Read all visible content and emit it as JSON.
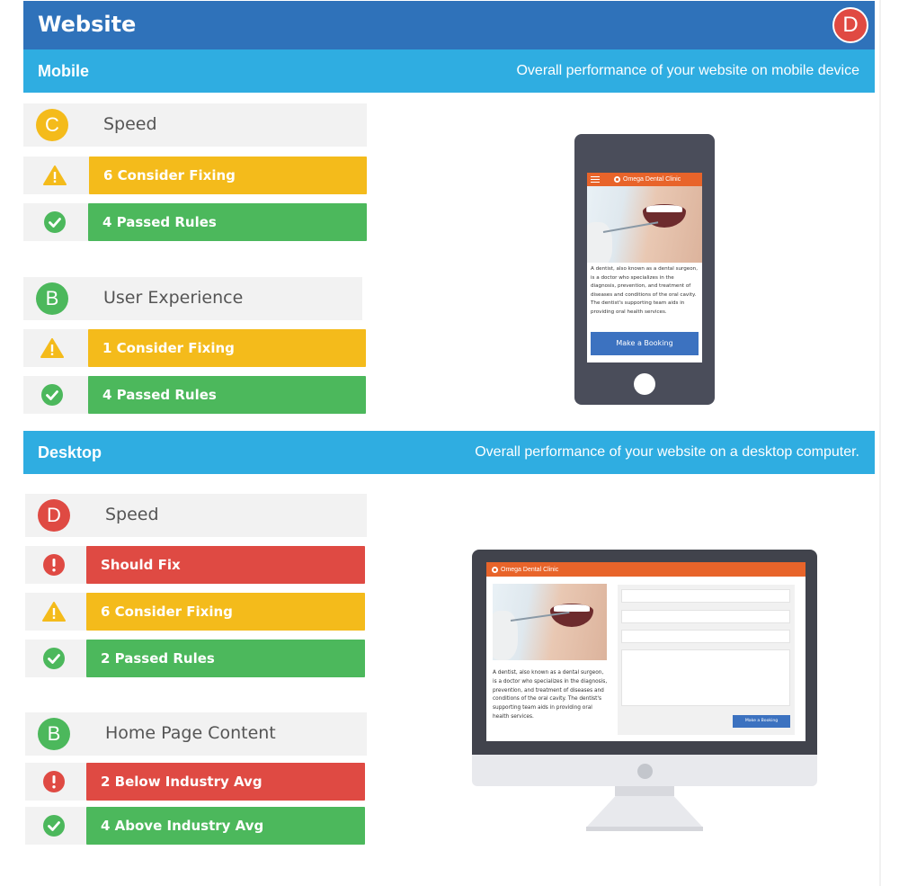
{
  "header": {
    "title": "Website",
    "overall_grade": "D",
    "overall_grade_color": "#e04a42"
  },
  "sections": {
    "mobile": {
      "name": "Mobile",
      "description": "Overall performance of your website on mobile device",
      "categories": [
        {
          "grade": "C",
          "grade_color": "#f4bb1b",
          "label": "Speed",
          "items": [
            {
              "icon": "warning-icon",
              "status": "consider",
              "text": "6 Consider Fixing"
            },
            {
              "icon": "check-circle-icon",
              "status": "passed",
              "text": "4 Passed Rules"
            }
          ]
        },
        {
          "grade": "B",
          "grade_color": "#4cb85c",
          "label": "User Experience",
          "items": [
            {
              "icon": "warning-icon",
              "status": "consider",
              "text": "1 Consider Fixing"
            },
            {
              "icon": "check-circle-icon",
              "status": "passed",
              "text": "4 Passed Rules"
            }
          ]
        }
      ]
    },
    "desktop": {
      "name": "Desktop",
      "description": "Overall performance of your website on a desktop computer.",
      "categories": [
        {
          "grade": "D",
          "grade_color": "#df4a43",
          "label": "Speed",
          "items": [
            {
              "icon": "exclamation-circle-icon",
              "status": "should-fix",
              "text": "Should Fix"
            },
            {
              "icon": "warning-icon",
              "status": "consider",
              "text": "6 Consider Fixing"
            },
            {
              "icon": "check-circle-icon",
              "status": "passed",
              "text": "2 Passed Rules"
            }
          ]
        },
        {
          "grade": "B",
          "grade_color": "#4cb85c",
          "label": "Home Page Content",
          "items": [
            {
              "icon": "exclamation-circle-icon",
              "status": "below",
              "text": "2 Below Industry Avg"
            },
            {
              "icon": "check-circle-icon",
              "status": "above",
              "text": "4 Above Industry Avg"
            }
          ]
        }
      ]
    }
  },
  "preview": {
    "site_name": "Omega Dental Clinic",
    "body_text": "A dentist, also known as a dental surgeon, is a doctor who specializes in the diagnosis, prevention, and treatment of diseases and conditions of the oral cavity. The dentist's supporting team aids in providing oral health services.",
    "booking_button": "Make a Booking",
    "brand_color": "#e8642a",
    "button_color": "#3c72c0"
  },
  "colors": {
    "header": "#2f72ba",
    "section_bar": "#2fade1",
    "warning": "#f4bb1b",
    "passed": "#4cb85c",
    "error": "#df4a43"
  }
}
